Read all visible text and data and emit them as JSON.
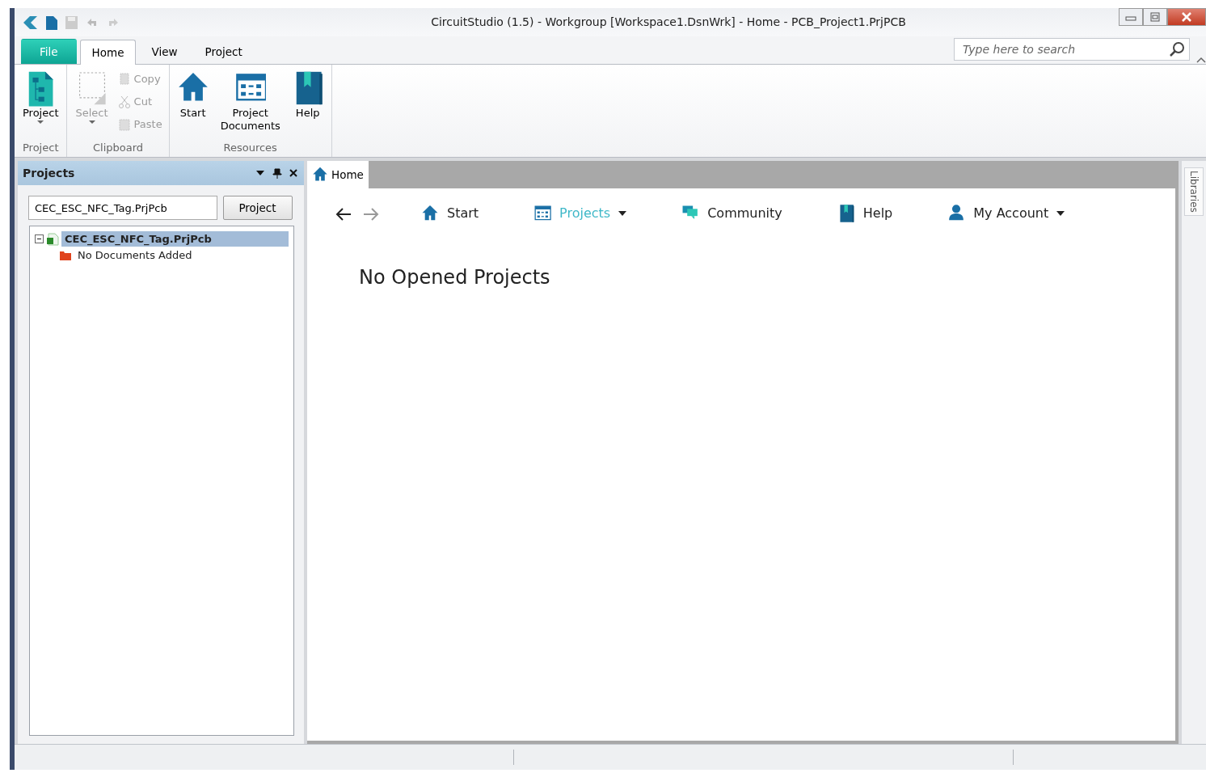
{
  "window": {
    "title": "CircuitStudio (1.5) - Workgroup [Workspace1.DsnWrk] - Home - PCB_Project1.PrjPCB"
  },
  "ribbon_tabs": [
    {
      "label": "File",
      "kind": "file",
      "selected": false
    },
    {
      "label": "Home",
      "kind": "tab",
      "selected": true
    },
    {
      "label": "View",
      "kind": "tab",
      "selected": false
    },
    {
      "label": "Project",
      "kind": "tab",
      "selected": false
    }
  ],
  "search": {
    "placeholder": "Type here to search"
  },
  "ribbon_groups": [
    {
      "label": "Project",
      "items": [
        {
          "label": "Project",
          "kind": "large",
          "dropdown": true,
          "disabled": false
        }
      ]
    },
    {
      "label": "Clipboard",
      "items": [
        {
          "label": "Select",
          "kind": "large",
          "dropdown": true,
          "disabled": true
        },
        {
          "label": "Copy",
          "kind": "small",
          "disabled": true
        },
        {
          "label": "Cut",
          "kind": "small",
          "disabled": true
        },
        {
          "label": "Paste",
          "kind": "small",
          "disabled": true
        }
      ]
    },
    {
      "label": "Resources",
      "items": [
        {
          "label": "Start",
          "kind": "large",
          "dropdown": false,
          "disabled": false
        },
        {
          "label": "Project Documents",
          "kind": "large",
          "dropdown": false,
          "disabled": false
        },
        {
          "label": "Help",
          "kind": "large",
          "dropdown": false,
          "disabled": false
        }
      ]
    }
  ],
  "projects_panel": {
    "title": "Projects",
    "project_field": {
      "value": "CEC_ESC_NFC_Tag.PrjPcb"
    },
    "project_button": "Project",
    "tree": [
      {
        "label": "CEC_ESC_NFC_Tag.PrjPcb",
        "expanded": true,
        "selected": true,
        "children": [
          {
            "label": "No Documents Added",
            "selected": false
          }
        ]
      }
    ]
  },
  "document_tabs": [
    {
      "label": "Home",
      "selected": true
    }
  ],
  "home_nav": [
    {
      "label": "Start",
      "selected": false,
      "dropdown": false
    },
    {
      "label": "Projects",
      "selected": true,
      "dropdown": true
    },
    {
      "label": "Community",
      "selected": false,
      "dropdown": false
    },
    {
      "label": "Help",
      "selected": false,
      "dropdown": false
    },
    {
      "label": "My Account",
      "selected": false,
      "dropdown": true
    }
  ],
  "heading": "No Opened Projects",
  "side_panels": [
    {
      "label": "Libraries"
    }
  ]
}
